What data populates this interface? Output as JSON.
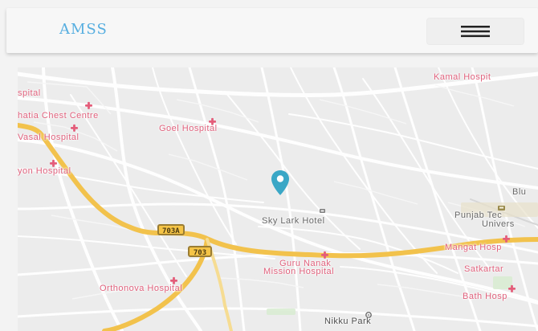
{
  "header": {
    "brand": "AMSS",
    "menu_icon": "hamburger-icon",
    "colors": {
      "brand": "#56aee0",
      "navbar": "#f7f7f7"
    }
  },
  "map": {
    "labels": [
      {
        "text": "Kamal Hospit",
        "kind": "red"
      },
      {
        "text": "spital",
        "kind": "red"
      },
      {
        "text": "hatia Chest Centre",
        "kind": "red"
      },
      {
        "text": "Goel Hospital",
        "kind": "red"
      },
      {
        "text": "Vasal Hospital",
        "kind": "red"
      },
      {
        "text": "yon Hospital",
        "kind": "red"
      },
      {
        "text": "Sky Lark Hotel",
        "kind": "gray"
      },
      {
        "text": "Punjab Tec",
        "kind": "gray"
      },
      {
        "text": "Univers",
        "kind": "gray"
      },
      {
        "text": "Blu",
        "kind": "gray"
      },
      {
        "text": "Mangat Hosp",
        "kind": "red"
      },
      {
        "text": "Guru Nanak",
        "kind": "red"
      },
      {
        "text": "Mission Hospital",
        "kind": "red"
      },
      {
        "text": "Satkartar",
        "kind": "red"
      },
      {
        "text": "Orthonova Hospital",
        "kind": "red"
      },
      {
        "text": "Bath Hosp",
        "kind": "red"
      },
      {
        "text": "Nikku Park",
        "kind": "dark"
      }
    ],
    "shields": [
      "703A",
      "703"
    ],
    "pin_icon": "location-pin-icon",
    "colors": {
      "primary_road": "#f0c34e",
      "pin": "#3aa7c6",
      "hospital_marker": "#e45d7a"
    }
  }
}
